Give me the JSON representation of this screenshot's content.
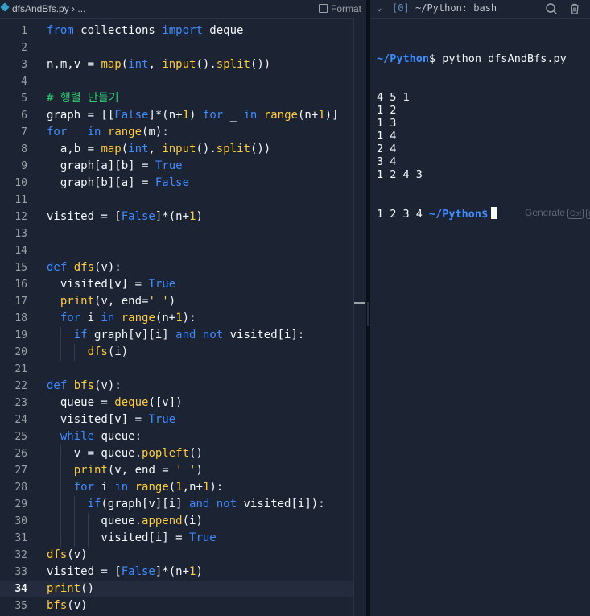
{
  "editor": {
    "tab_title": "dfsAndBfs.py › ...",
    "format_label": "Format",
    "active_line": 34,
    "lines": [
      {
        "n": "1",
        "tokens": [
          {
            "t": "from",
            "c": "kw"
          },
          {
            "t": " collections "
          },
          {
            "t": "import",
            "c": "kw"
          },
          {
            "t": " deque"
          }
        ]
      },
      {
        "n": "2",
        "tokens": []
      },
      {
        "n": "3",
        "tokens": [
          {
            "t": "n,m,v = "
          },
          {
            "t": "map",
            "c": "fn"
          },
          {
            "t": "("
          },
          {
            "t": "int",
            "c": "bi"
          },
          {
            "t": ", "
          },
          {
            "t": "input",
            "c": "fn"
          },
          {
            "t": "()."
          },
          {
            "t": "split",
            "c": "fn"
          },
          {
            "t": "())"
          }
        ]
      },
      {
        "n": "4",
        "tokens": []
      },
      {
        "n": "5",
        "tokens": [
          {
            "t": "# 행렬 만들기",
            "c": "cm"
          }
        ]
      },
      {
        "n": "6",
        "tokens": [
          {
            "t": "graph = [["
          },
          {
            "t": "False",
            "c": "bi"
          },
          {
            "t": "]*(n+"
          },
          {
            "t": "1",
            "c": "nm"
          },
          {
            "t": ") "
          },
          {
            "t": "for",
            "c": "kw"
          },
          {
            "t": " _ "
          },
          {
            "t": "in",
            "c": "kw"
          },
          {
            "t": " "
          },
          {
            "t": "range",
            "c": "fn"
          },
          {
            "t": "(n+"
          },
          {
            "t": "1",
            "c": "nm"
          },
          {
            "t": ")]"
          }
        ]
      },
      {
        "n": "7",
        "tokens": [
          {
            "t": "for",
            "c": "kw"
          },
          {
            "t": " _ "
          },
          {
            "t": "in",
            "c": "kw"
          },
          {
            "t": " "
          },
          {
            "t": "range",
            "c": "fn"
          },
          {
            "t": "(m):"
          }
        ]
      },
      {
        "n": "8",
        "tokens": [
          {
            "t": "  a,b = "
          },
          {
            "t": "map",
            "c": "fn"
          },
          {
            "t": "("
          },
          {
            "t": "int",
            "c": "bi"
          },
          {
            "t": ", "
          },
          {
            "t": "input",
            "c": "fn"
          },
          {
            "t": "()."
          },
          {
            "t": "split",
            "c": "fn"
          },
          {
            "t": "())"
          }
        ]
      },
      {
        "n": "9",
        "tokens": [
          {
            "t": "  graph[a][b] = "
          },
          {
            "t": "True",
            "c": "bi"
          }
        ]
      },
      {
        "n": "10",
        "tokens": [
          {
            "t": "  graph[b][a] = "
          },
          {
            "t": "False",
            "c": "bi"
          }
        ]
      },
      {
        "n": "11",
        "tokens": []
      },
      {
        "n": "12",
        "tokens": [
          {
            "t": "visited = ["
          },
          {
            "t": "False",
            "c": "bi"
          },
          {
            "t": "]*(n+"
          },
          {
            "t": "1",
            "c": "nm"
          },
          {
            "t": ")"
          }
        ]
      },
      {
        "n": "13",
        "tokens": []
      },
      {
        "n": "14",
        "tokens": []
      },
      {
        "n": "15",
        "tokens": [
          {
            "t": "def",
            "c": "kw"
          },
          {
            "t": " "
          },
          {
            "t": "dfs",
            "c": "fn"
          },
          {
            "t": "(v):"
          }
        ]
      },
      {
        "n": "16",
        "tokens": [
          {
            "t": "  visited[v] = "
          },
          {
            "t": "True",
            "c": "bi"
          }
        ]
      },
      {
        "n": "17",
        "tokens": [
          {
            "t": "  "
          },
          {
            "t": "print",
            "c": "fn"
          },
          {
            "t": "(v, end="
          },
          {
            "t": "' '",
            "c": "st"
          },
          {
            "t": ")"
          }
        ]
      },
      {
        "n": "18",
        "tokens": [
          {
            "t": "  "
          },
          {
            "t": "for",
            "c": "kw"
          },
          {
            "t": " i "
          },
          {
            "t": "in",
            "c": "kw"
          },
          {
            "t": " "
          },
          {
            "t": "range",
            "c": "fn"
          },
          {
            "t": "(n+"
          },
          {
            "t": "1",
            "c": "nm"
          },
          {
            "t": "):"
          }
        ]
      },
      {
        "n": "19",
        "tokens": [
          {
            "t": "    "
          },
          {
            "t": "if",
            "c": "kw"
          },
          {
            "t": " graph[v][i] "
          },
          {
            "t": "and",
            "c": "kw"
          },
          {
            "t": " "
          },
          {
            "t": "not",
            "c": "kw"
          },
          {
            "t": " visited[i]:"
          }
        ]
      },
      {
        "n": "20",
        "tokens": [
          {
            "t": "      "
          },
          {
            "t": "dfs",
            "c": "fn"
          },
          {
            "t": "(i)"
          }
        ]
      },
      {
        "n": "21",
        "tokens": []
      },
      {
        "n": "22",
        "tokens": [
          {
            "t": "def",
            "c": "kw"
          },
          {
            "t": " "
          },
          {
            "t": "bfs",
            "c": "fn"
          },
          {
            "t": "(v):"
          }
        ]
      },
      {
        "n": "23",
        "tokens": [
          {
            "t": "  queue = "
          },
          {
            "t": "deque",
            "c": "fn"
          },
          {
            "t": "([v])"
          }
        ]
      },
      {
        "n": "24",
        "tokens": [
          {
            "t": "  visited[v] = "
          },
          {
            "t": "True",
            "c": "bi"
          }
        ]
      },
      {
        "n": "25",
        "tokens": [
          {
            "t": "  "
          },
          {
            "t": "while",
            "c": "kw"
          },
          {
            "t": " queue:"
          }
        ]
      },
      {
        "n": "26",
        "tokens": [
          {
            "t": "    v = queue."
          },
          {
            "t": "popleft",
            "c": "fn"
          },
          {
            "t": "()"
          }
        ]
      },
      {
        "n": "27",
        "tokens": [
          {
            "t": "    "
          },
          {
            "t": "print",
            "c": "fn"
          },
          {
            "t": "(v, end = "
          },
          {
            "t": "' '",
            "c": "st"
          },
          {
            "t": ")"
          }
        ]
      },
      {
        "n": "28",
        "tokens": [
          {
            "t": "    "
          },
          {
            "t": "for",
            "c": "kw"
          },
          {
            "t": " i "
          },
          {
            "t": "in",
            "c": "kw"
          },
          {
            "t": " "
          },
          {
            "t": "range",
            "c": "fn"
          },
          {
            "t": "("
          },
          {
            "t": "1",
            "c": "nm"
          },
          {
            "t": ",n+"
          },
          {
            "t": "1",
            "c": "nm"
          },
          {
            "t": "):"
          }
        ]
      },
      {
        "n": "29",
        "tokens": [
          {
            "t": "      "
          },
          {
            "t": "if",
            "c": "kw"
          },
          {
            "t": "(graph[v][i] "
          },
          {
            "t": "and",
            "c": "kw"
          },
          {
            "t": " "
          },
          {
            "t": "not",
            "c": "kw"
          },
          {
            "t": " visited[i]):"
          }
        ]
      },
      {
        "n": "30",
        "tokens": [
          {
            "t": "        queue."
          },
          {
            "t": "append",
            "c": "fn"
          },
          {
            "t": "(i)"
          }
        ]
      },
      {
        "n": "31",
        "tokens": [
          {
            "t": "        visited[i] = "
          },
          {
            "t": "True",
            "c": "bi"
          }
        ]
      },
      {
        "n": "32",
        "tokens": [
          {
            "t": "dfs",
            "c": "fn"
          },
          {
            "t": "(v)"
          }
        ]
      },
      {
        "n": "33",
        "tokens": [
          {
            "t": "visited = ["
          },
          {
            "t": "False",
            "c": "bi"
          },
          {
            "t": "]*(n+"
          },
          {
            "t": "1",
            "c": "nm"
          },
          {
            "t": ")"
          }
        ]
      },
      {
        "n": "34",
        "tokens": [
          {
            "t": "print",
            "c": "fn"
          },
          {
            "t": "()"
          }
        ]
      },
      {
        "n": "35",
        "tokens": [
          {
            "t": "bfs",
            "c": "fn"
          },
          {
            "t": "(v)"
          }
        ]
      }
    ]
  },
  "terminal": {
    "tab_index": "[0]",
    "title": "~/Python: bash",
    "prompt_path": "~/Python",
    "command": "$ python dfsAndBfs.py",
    "output_lines": [
      "4 5 1",
      "1 2",
      "1 3",
      "1 4",
      "2 4",
      "3 4",
      "1 2 4 3"
    ],
    "last_output": "1 2 3 4 ",
    "last_prompt_suffix": "$",
    "generate_label": "Generate",
    "generate_kbd": "Ctrl",
    "generate_kbd2": "I"
  }
}
